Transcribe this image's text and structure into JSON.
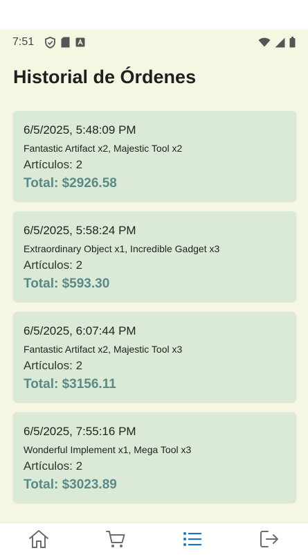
{
  "status_bar": {
    "time": "7:51"
  },
  "page": {
    "title": "Historial de Órdenes"
  },
  "orders": [
    {
      "date": "6/5/2025, 5:48:09 PM",
      "items": "Fantastic Artifact x2, Majestic Tool x2",
      "count": "Artículos: 2",
      "total": "Total: $2926.58"
    },
    {
      "date": "6/5/2025, 5:58:24 PM",
      "items": "Extraordinary Object x1, Incredible Gadget x3",
      "count": "Artículos: 2",
      "total": "Total: $593.30"
    },
    {
      "date": "6/5/2025, 6:07:44 PM",
      "items": "Fantastic Artifact x2, Majestic Tool x3",
      "count": "Artículos: 2",
      "total": "Total: $3156.11"
    },
    {
      "date": "6/5/2025, 7:55:16 PM",
      "items": "Wonderful Implement x1, Mega Tool x3",
      "count": "Artículos: 2",
      "total": "Total: $3023.89"
    }
  ],
  "bottom_nav": {
    "items": [
      {
        "icon": "home-icon",
        "active": false
      },
      {
        "icon": "cart-icon",
        "active": false
      },
      {
        "icon": "list-icon",
        "active": true
      },
      {
        "icon": "logout-icon",
        "active": false
      }
    ]
  },
  "colors": {
    "background": "#f6f7e2",
    "card": "#dbead6",
    "total_text": "#5a8a87",
    "nav_active": "#1976d2",
    "nav_inactive": "#6b6b6b"
  }
}
